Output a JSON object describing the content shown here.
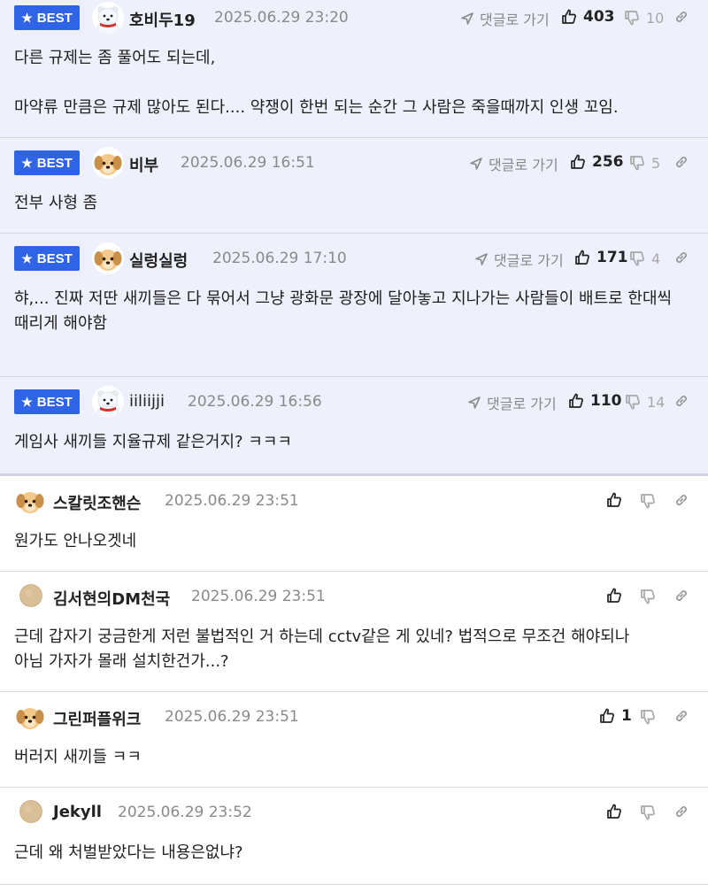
{
  "comments": [
    {
      "best": true,
      "badge": "BEST",
      "avatar": "polar-bear",
      "nickname": "호비두19",
      "date": "2025.06.29 23:20",
      "reply_label": "댓글로 가기",
      "likes": "403",
      "dislikes": "10",
      "text": "다른 규제는 좀 풀어도 되는데,\n\n마약류 만큼은 규제 많아도 된다.... 약쟁이 한번 되는 순간 그 사람은 죽을때까지 인생 꼬임."
    },
    {
      "best": true,
      "badge": "BEST",
      "avatar": "puppy",
      "nickname": "비부",
      "date": "2025.06.29 16:51",
      "reply_label": "댓글로 가기",
      "likes": "256",
      "dislikes": "5",
      "text": "전부 사형 좀"
    },
    {
      "best": true,
      "badge": "BEST",
      "avatar": "puppy",
      "nickname": "실렁실렁",
      "date": "2025.06.29 17:10",
      "reply_label": "댓글로 가기",
      "likes": "171",
      "dislikes": "4",
      "text": "햐,... 진짜 저딴 새끼들은 다 묶어서 그냥 광화문 광장에 달아놓고 지나가는 사람들이 배트로 한대씩\n때리게 해야함"
    },
    {
      "best": true,
      "badge": "BEST",
      "avatar": "polar-bear",
      "nickname": "iiliijji",
      "date": "2025.06.29 16:56",
      "reply_label": "댓글로 가기",
      "likes": "110",
      "dislikes": "14",
      "text": "게임사 새끼들 지율규제 같은거지? ㅋㅋㅋ"
    },
    {
      "best": false,
      "avatar": "puppy",
      "nickname": "스칼릿조핸슨",
      "date": "2025.06.29 23:51",
      "likes": "",
      "dislikes": "",
      "text": "원가도 안나오겟네"
    },
    {
      "best": false,
      "avatar": "default-circle",
      "nickname": "김서현의DM천국",
      "date": "2025.06.29 23:51",
      "likes": "",
      "dislikes": "",
      "text": "근데 갑자기 궁금한게 저런 불법적인 거 하는데 cctv같은 게 있네? 법적으로 무조건 해야되나\n아님 가자가 몰래 설치한건가...?"
    },
    {
      "best": false,
      "avatar": "puppy",
      "nickname": "그린퍼플위크",
      "date": "2025.06.29 23:51",
      "likes": "1",
      "dislikes": "",
      "text": "버러지 새끼들 ㅋㅋ"
    },
    {
      "best": false,
      "avatar": "default-circle",
      "nickname": "Jekyll",
      "date": "2025.06.29 23:52",
      "likes": "",
      "dislikes": "",
      "text": "근데 왜 처벌받았다는 내용은없냐?"
    }
  ],
  "icons": {
    "reply": "navigation-arrow-icon",
    "like": "thumbs-up-icon",
    "dislike": "thumbs-down-icon",
    "share": "link-icon",
    "badge": "star-icon"
  },
  "colors": {
    "best_background": "#eef0fb",
    "badge": "#2f64e6",
    "divider": "#d5d8e2"
  }
}
